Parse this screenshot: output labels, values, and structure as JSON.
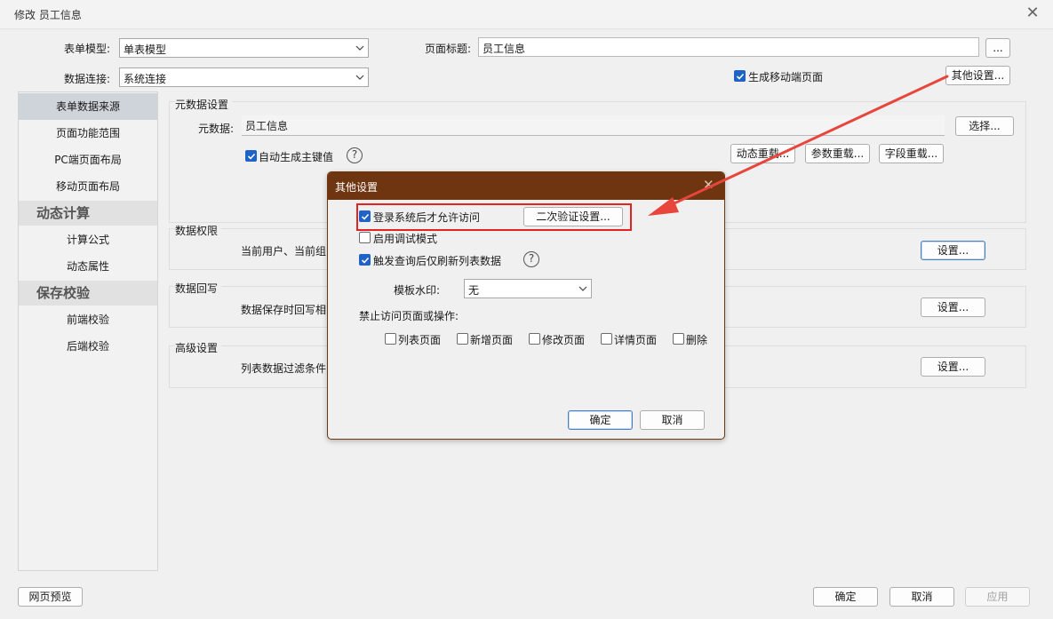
{
  "window": {
    "title": "修改 员工信息",
    "close_glyph": "✕"
  },
  "form": {
    "model_label": "表单模型:",
    "model_value": "单表模型",
    "connection_label": "数据连接:",
    "connection_value": "系统连接",
    "page_title_label": "页面标题:",
    "page_title_value": "员工信息",
    "more_button": "...",
    "mobile_checkbox_label": "生成移动端页面",
    "mobile_checked": true,
    "other_settings_button": "其他设置..."
  },
  "sidebar": {
    "items": [
      {
        "label": "表单数据来源",
        "active": true
      },
      {
        "label": "页面功能范围"
      },
      {
        "label": "PC端页面布局"
      },
      {
        "label": "移动页面布局"
      }
    ],
    "group_dynamic": "动态计算",
    "dynamic_items": [
      {
        "label": "计算公式"
      },
      {
        "label": "动态属性"
      }
    ],
    "group_save": "保存校验",
    "save_items": [
      {
        "label": "前端校验"
      },
      {
        "label": "后端校验"
      }
    ]
  },
  "metadata_section": {
    "title": "元数据设置",
    "metadata_label": "元数据:",
    "metadata_value": "员工信息",
    "select_button": "选择...",
    "auto_pk_label": "自动生成主键值",
    "auto_pk_checked": true,
    "help_glyph": "?",
    "reload_buttons": [
      "动态重载...",
      "参数重载...",
      "字段重载..."
    ]
  },
  "permission_section": {
    "title": "数据权限",
    "text": "当前用户、当前组",
    "button": "设置..."
  },
  "writeback_section": {
    "title": "数据回写",
    "text": "数据保存时回写相",
    "button": "设置..."
  },
  "advanced_section": {
    "title": "高级设置",
    "text": "列表数据过滤条件",
    "button": "设置..."
  },
  "footer": {
    "preview_button": "网页预览",
    "ok_button": "确定",
    "cancel_button": "取消",
    "apply_button": "应用"
  },
  "dialog": {
    "title": "其他设置",
    "close_glyph": "✕",
    "login_required_label": "登录系统后才允许访问",
    "login_required_checked": true,
    "second_verify_button": "二次验证设置...",
    "debug_mode_label": "启用调试模式",
    "debug_mode_checked": false,
    "refresh_label": "触发查询后仅刷新列表数据",
    "refresh_checked": true,
    "help_glyph": "?",
    "watermark_label": "模板水印:",
    "watermark_value": "无",
    "forbid_label": "禁止访问页面或操作:",
    "forbid_options": [
      {
        "label": "列表页面",
        "checked": false
      },
      {
        "label": "新增页面",
        "checked": false
      },
      {
        "label": "修改页面",
        "checked": false
      },
      {
        "label": "详情页面",
        "checked": false
      },
      {
        "label": "删除",
        "checked": false
      }
    ],
    "ok_button": "确定",
    "cancel_button": "取消"
  },
  "colors": {
    "dialog_header": "#6f3511",
    "highlight_border": "#e32222",
    "arrow": "#e8453c",
    "checkbox_accent": "#1f62c8",
    "sidebar_active": "#cfd3da"
  }
}
